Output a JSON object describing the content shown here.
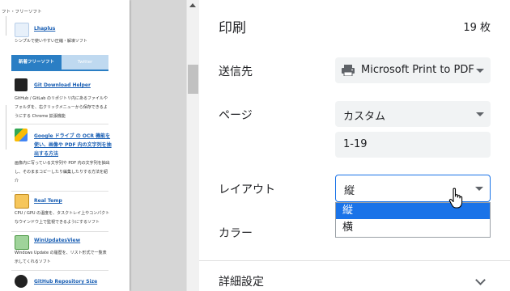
{
  "preview": {
    "breadcrumb": "フト・フリーソフト",
    "items": [
      {
        "title": "Lhaplus",
        "desc": "シンプルで使いやすい圧縮・解凍ソフト"
      },
      {
        "title": "Git Download Helper",
        "desc": "GitHub / GitLab のリポジトリ内にあるファイルやフォルダを、右クリックメニューから保存できるようにする Chrome 拡張機能"
      },
      {
        "title": "Google ドライブ の OCR 機能を使い、画像や PDF 内の文字列を抽出する方法",
        "desc": "画像内に写っている文字列や PDF 内の文字列を抽出し、そのままコピーしたり編集したりする方法を紹介"
      },
      {
        "title": "Real Temp",
        "desc": "CPU / GPU の温度を、タスクトレイ上やコンパクトなウインドウ上で監視できるようにするソフト"
      },
      {
        "title": "WinUpdatesView",
        "desc": "Windows Update の履歴を、リスト形式で一覧表示してくれるソフト"
      },
      {
        "title": "GitHub Repository Size",
        "desc": ""
      }
    ],
    "tabs": [
      "新着フリーソフト",
      "Twitter"
    ]
  },
  "print": {
    "title": "印刷",
    "sheet_count": "19 枚",
    "destination_label": "送信先",
    "destination_value": "Microsoft Print to PDF",
    "pages_label": "ページ",
    "pages_value": "カスタム",
    "pages_range": "1-19",
    "layout_label": "レイアウト",
    "layout_value": "縦",
    "layout_options": [
      "縦",
      "横"
    ],
    "color_label": "カラー",
    "more_settings": "詳細設定"
  },
  "colors": {
    "accent": "#1a73e8",
    "tab_active": "#2a7ec4"
  },
  "icons": [
    "printer-icon",
    "chevron-down-icon",
    "hand-pointer-cursor",
    "scroll-up-arrow"
  ]
}
